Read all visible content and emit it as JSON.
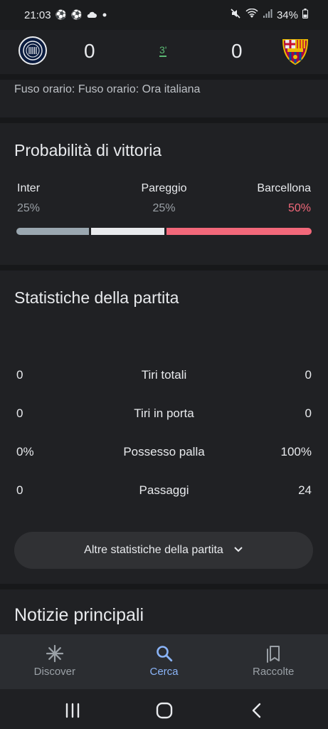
{
  "status_bar": {
    "time": "21:03",
    "left_icons": [
      "soccer-ball-icon",
      "soccer-ball-icon",
      "cloud-icon",
      "dot-icon"
    ],
    "right_icons": [
      "mute-icon",
      "wifi-icon",
      "signal-icon"
    ],
    "battery": "34%"
  },
  "match": {
    "home_team": "Inter",
    "away_team": "Barcellona",
    "home_score": "0",
    "away_score": "0",
    "minute": "3'"
  },
  "timezone": "Fuso orario: Fuso orario: Ora italiana",
  "probability": {
    "title": "Probabilità di vittoria",
    "items": [
      {
        "label": "Inter",
        "value": "25%",
        "fraction": 0.25,
        "color": "#9aa7b0"
      },
      {
        "label": "Pareggio",
        "value": "25%",
        "fraction": 0.25,
        "color": "#e8eaed"
      },
      {
        "label": "Barcellona",
        "value": "50%",
        "fraction": 0.5,
        "color": "#f2687a"
      }
    ]
  },
  "stats": {
    "title": "Statistiche della partita",
    "rows": [
      {
        "home": "0",
        "label": "Tiri totali",
        "away": "0"
      },
      {
        "home": "0",
        "label": "Tiri in porta",
        "away": "0"
      },
      {
        "home": "0%",
        "label": "Possesso palla",
        "away": "100%"
      },
      {
        "home": "0",
        "label": "Passaggi",
        "away": "24"
      }
    ],
    "more_label": "Altre statistiche della partita"
  },
  "news": {
    "title": "Notizie principali"
  },
  "bottom_nav": {
    "items": [
      {
        "label": "Discover",
        "icon": "asterisk-icon",
        "active": false
      },
      {
        "label": "Cerca",
        "icon": "search-icon",
        "active": true
      },
      {
        "label": "Raccolte",
        "icon": "collections-icon",
        "active": false
      }
    ]
  },
  "system_nav": [
    "recents-icon",
    "home-icon",
    "back-icon"
  ],
  "colors": {
    "accent": "#8ab4f8",
    "live_minute": "#5bb974",
    "away_win": "#f2687a"
  }
}
